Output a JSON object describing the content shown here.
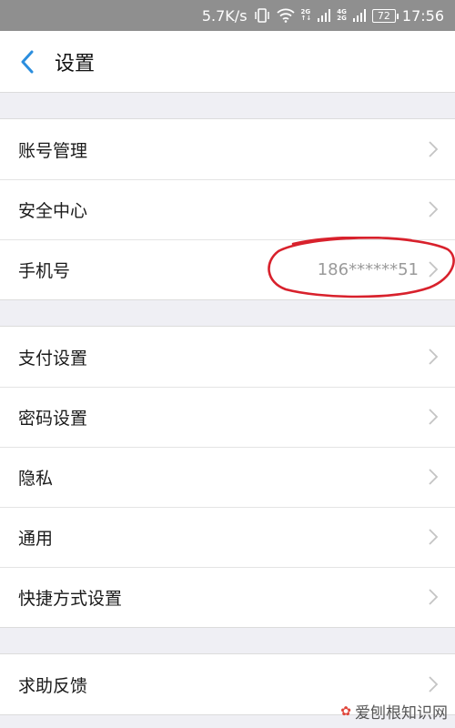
{
  "status_bar": {
    "speed": "5.7K/s",
    "net_2g": [
      "2G",
      "↑↓"
    ],
    "net_4g": [
      "4G",
      "2G"
    ],
    "battery": "72",
    "time": "17:56"
  },
  "header": {
    "title": "设置"
  },
  "groups": [
    {
      "items": [
        {
          "label": "账号管理",
          "value": ""
        },
        {
          "label": "安全中心",
          "value": ""
        },
        {
          "label": "手机号",
          "value": "186******51"
        }
      ]
    },
    {
      "items": [
        {
          "label": "支付设置",
          "value": ""
        },
        {
          "label": "密码设置",
          "value": ""
        },
        {
          "label": "隐私",
          "value": ""
        },
        {
          "label": "通用",
          "value": ""
        },
        {
          "label": "快捷方式设置",
          "value": ""
        }
      ]
    },
    {
      "items": [
        {
          "label": "求助反馈",
          "value": ""
        }
      ]
    }
  ],
  "watermark": {
    "text": "爱刨根知识网"
  },
  "colors": {
    "accent": "#2b8ede",
    "annotation": "#d8212c",
    "status_bar": "#8f8f8f"
  }
}
